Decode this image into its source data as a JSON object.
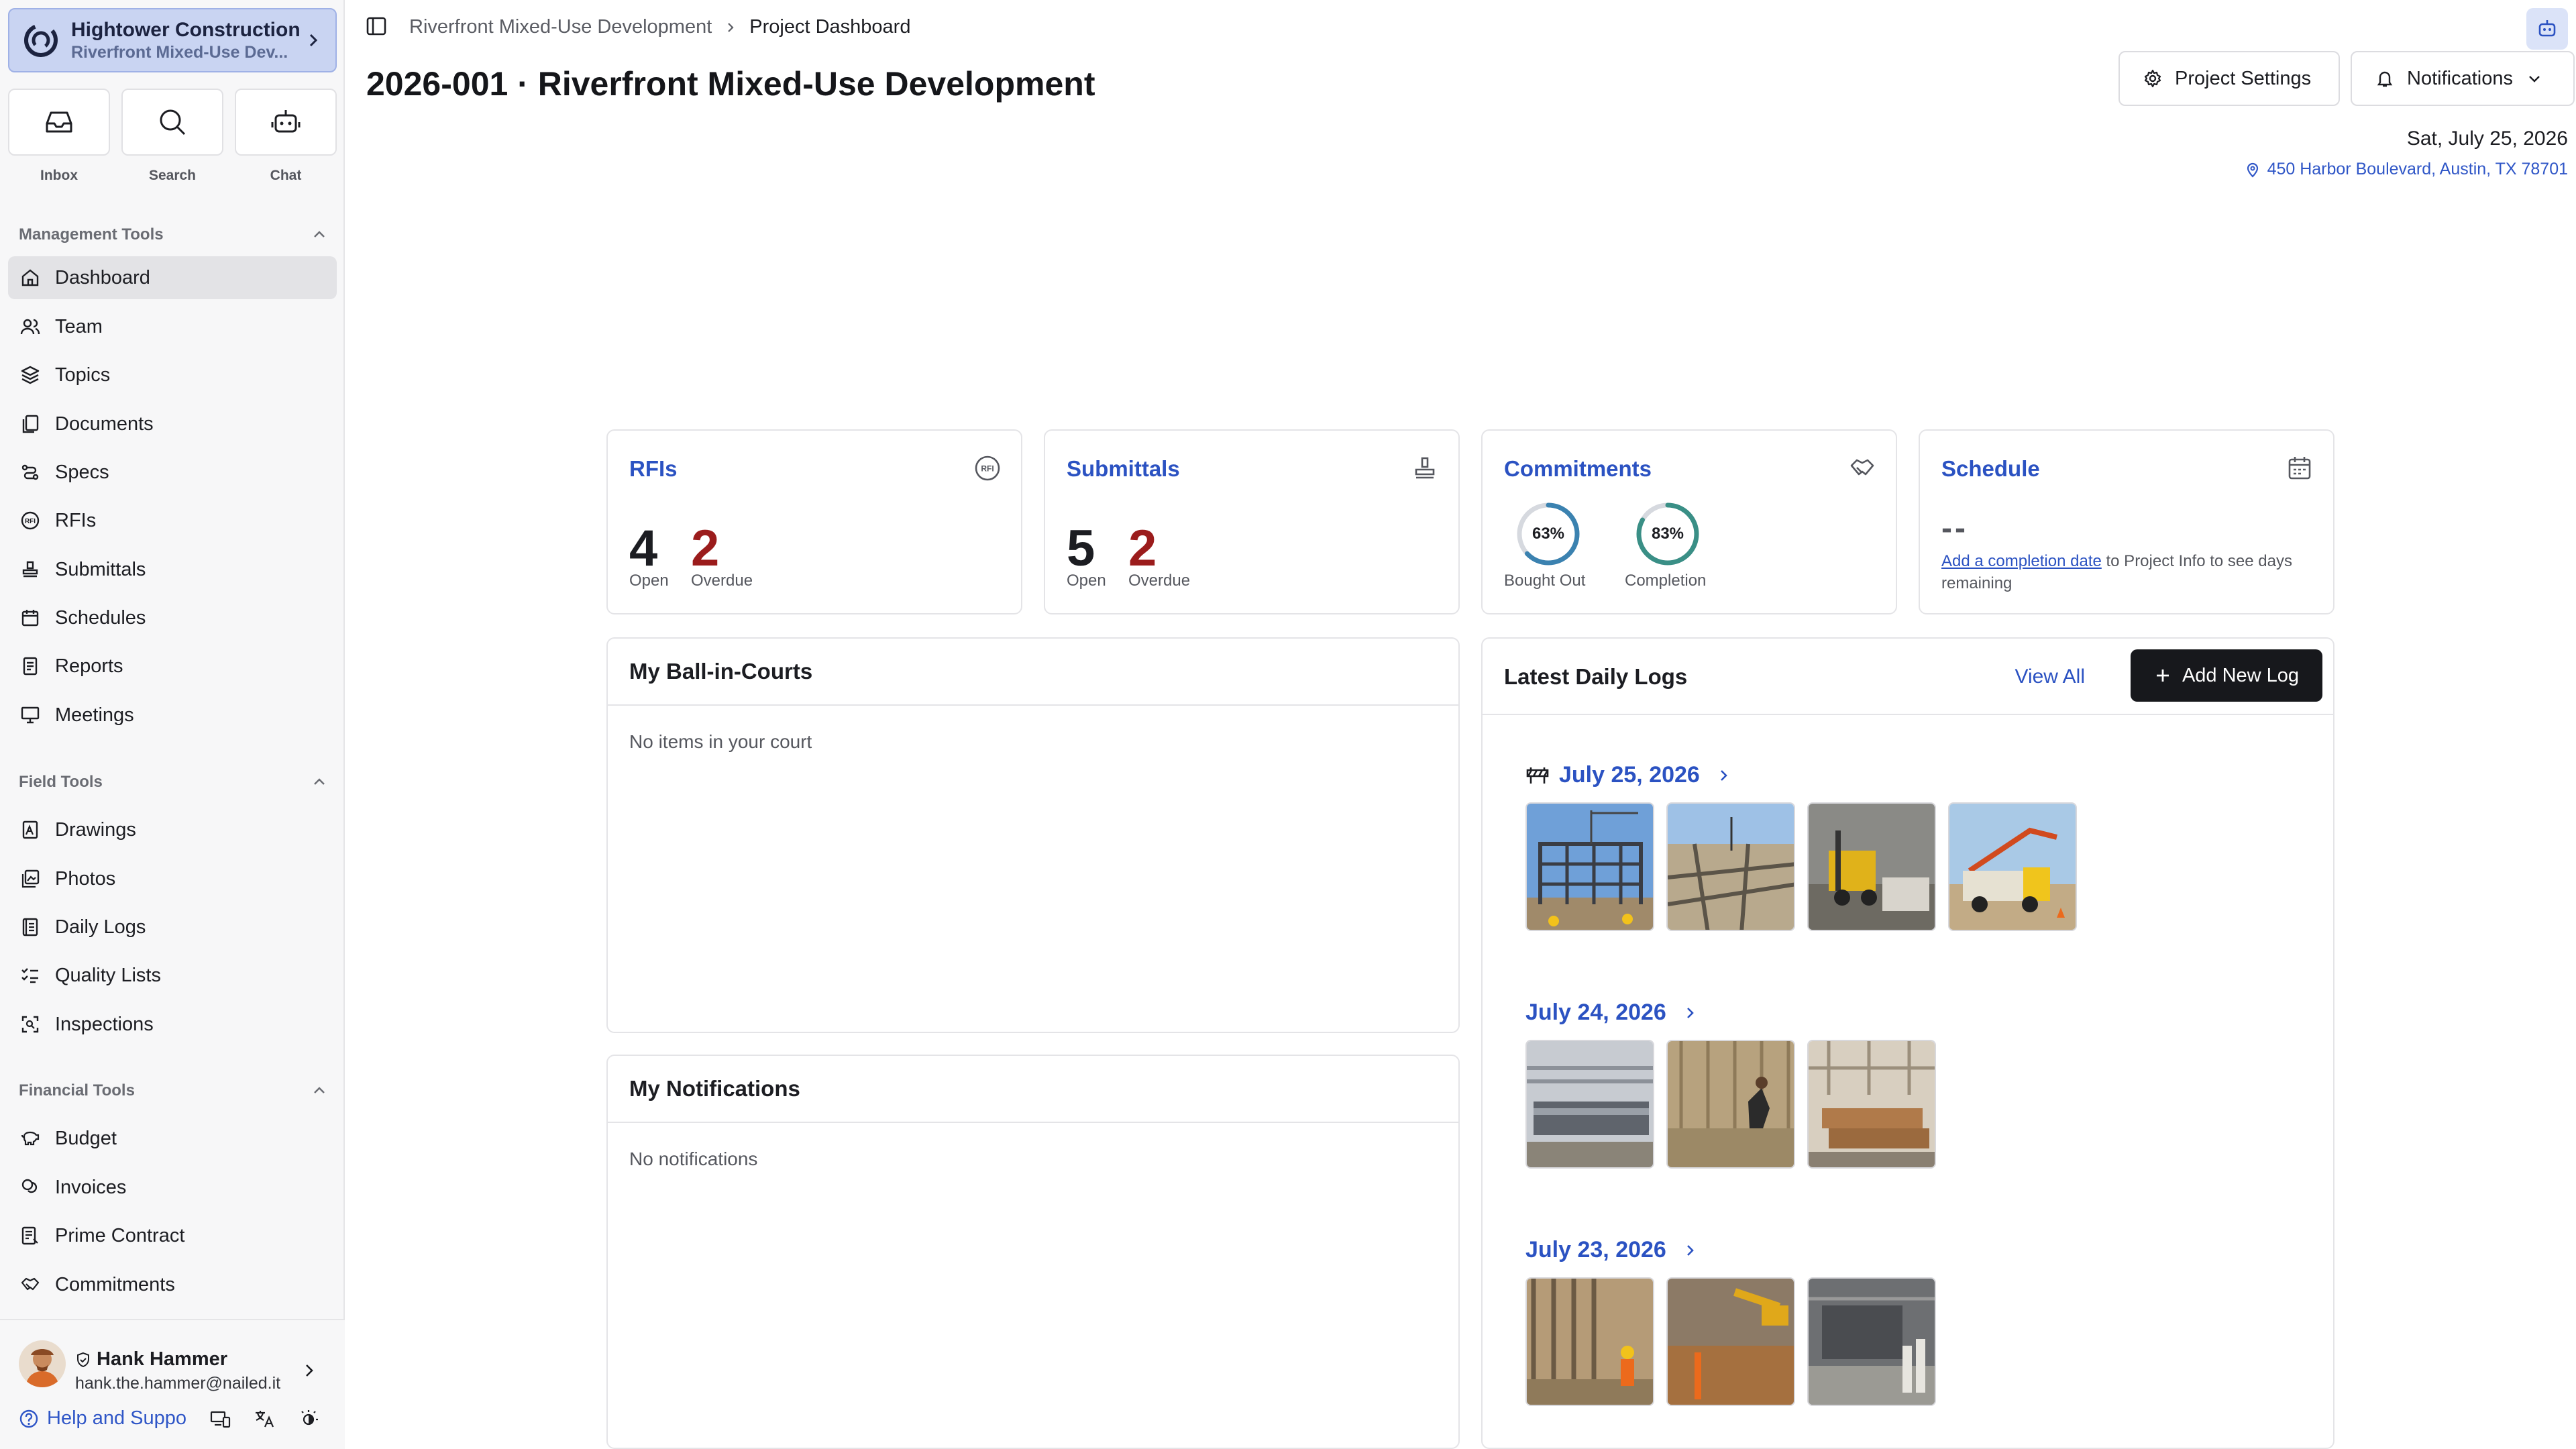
{
  "sidebar": {
    "org": {
      "name": "Hightower Construction",
      "project": "Riverfront Mixed-Use Dev..."
    },
    "quick": [
      {
        "label": "Inbox",
        "icon": "inbox-icon"
      },
      {
        "label": "Search",
        "icon": "search-icon"
      },
      {
        "label": "Chat",
        "icon": "robot-icon"
      }
    ],
    "sections": {
      "management": {
        "title": "Management Tools",
        "items": [
          {
            "label": "Dashboard",
            "icon": "home-icon",
            "active": true
          },
          {
            "label": "Team",
            "icon": "users-icon"
          },
          {
            "label": "Topics",
            "icon": "layers-icon"
          },
          {
            "label": "Documents",
            "icon": "files-icon"
          },
          {
            "label": "Specs",
            "icon": "specs-icon"
          },
          {
            "label": "RFIs",
            "icon": "rfi-icon"
          },
          {
            "label": "Submittals",
            "icon": "stamp-icon"
          },
          {
            "label": "Schedules",
            "icon": "calendar-icon"
          },
          {
            "label": "Reports",
            "icon": "report-icon"
          },
          {
            "label": "Meetings",
            "icon": "presentation-icon"
          }
        ]
      },
      "field": {
        "title": "Field Tools",
        "items": [
          {
            "label": "Drawings",
            "icon": "drawing-icon"
          },
          {
            "label": "Photos",
            "icon": "photos-icon"
          },
          {
            "label": "Daily Logs",
            "icon": "log-icon"
          },
          {
            "label": "Quality Lists",
            "icon": "checklist-icon"
          },
          {
            "label": "Inspections",
            "icon": "scan-icon"
          }
        ]
      },
      "financial": {
        "title": "Financial Tools",
        "items": [
          {
            "label": "Budget",
            "icon": "piggy-icon"
          },
          {
            "label": "Invoices",
            "icon": "coins-icon"
          },
          {
            "label": "Prime Contract",
            "icon": "contract-icon"
          },
          {
            "label": "Commitments",
            "icon": "handshake-icon"
          }
        ]
      }
    },
    "user": {
      "name": "Hank Hammer",
      "email": "hank.the.hammer@nailed.it"
    },
    "help": {
      "label": "Help and Suppo"
    }
  },
  "header": {
    "breadcrumb": [
      "Riverfront Mixed-Use Development",
      "Project Dashboard"
    ],
    "title": "2026-001 · Riverfront Mixed-Use Development",
    "settings_label": "Project Settings",
    "notifications_label": "Notifications",
    "date": "Sat, July 25, 2026",
    "address": "450 Harbor Boulevard, Austin, TX 78701"
  },
  "cards": {
    "rfis": {
      "title": "RFIs",
      "open": "4",
      "open_label": "Open",
      "overdue": "2",
      "overdue_label": "Overdue"
    },
    "submittals": {
      "title": "Submittals",
      "open": "5",
      "open_label": "Open",
      "overdue": "2",
      "overdue_label": "Overdue"
    },
    "commitments": {
      "title": "Commitments",
      "bought_out": "63%",
      "bought_out_value": 0.63,
      "bought_out_label": "Bought Out",
      "completion": "83%",
      "completion_value": 0.83,
      "completion_label": "Completion"
    },
    "schedule": {
      "title": "Schedule",
      "placeholder": "--",
      "link_text": "Add a completion date",
      "rest_text": " to Project Info to see days remaining"
    }
  },
  "ball_in_court": {
    "title": "My Ball-in-Courts",
    "empty": "No items in your court"
  },
  "notifications_panel": {
    "title": "My Notifications",
    "empty": "No notifications"
  },
  "daily_logs": {
    "title": "Latest Daily Logs",
    "view_all": "View All",
    "add_label": "Add New Log",
    "entries": [
      {
        "date": "July 25, 2026",
        "photos": 4
      },
      {
        "date": "July 24, 2026",
        "photos": 3
      },
      {
        "date": "July 23, 2026",
        "photos": 3
      }
    ]
  },
  "colors": {
    "accent": "#2b52c2",
    "overdue": "#9b1c1c",
    "ring": "#3b82b0",
    "active_bg": "#e3e3e6"
  }
}
